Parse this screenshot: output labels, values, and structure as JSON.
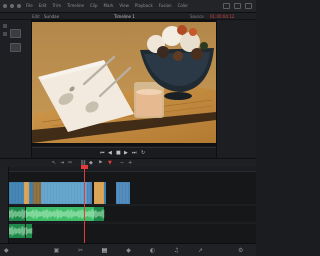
{
  "menu_bar": {
    "items": [
      "File",
      "Edit",
      "Trim",
      "Timeline",
      "Clip",
      "Mark",
      "View",
      "Playback",
      "Fusion",
      "Color"
    ]
  },
  "subbar": {
    "left_label": "Edit",
    "project_name": "Sundae",
    "timeline_title": "Timeline 1",
    "right_label": "Source",
    "timecode": "01:00:04:12"
  },
  "viewer": {
    "scene": "sundae-on-tray"
  },
  "transport": {
    "prev_label": "⏮",
    "back_label": "◀",
    "stop_label": "■",
    "play_label": "▶",
    "next_label": "⏭",
    "loop_label": "↻"
  },
  "tools": {
    "pointer": "↖",
    "trim": "⇥",
    "blade": "✂",
    "link": "⛓",
    "snap": "◆",
    "flag": "⚑",
    "marker": "▼",
    "zoom_in": "+",
    "zoom_out": "−"
  },
  "timeline": {
    "video_clip_colors": [
      "#3d7fb0",
      "#5ea0c9",
      "#8a6a3a",
      "#d8a050",
      "#4a86b8"
    ],
    "audio_colors": [
      "#1f8a4c",
      "#3fbf6a"
    ]
  },
  "pages": {
    "items": [
      {
        "name": "media",
        "glyph": "▣"
      },
      {
        "name": "cut",
        "glyph": "✂"
      },
      {
        "name": "edit",
        "glyph": "▤"
      },
      {
        "name": "fusion",
        "glyph": "◆"
      },
      {
        "name": "color",
        "glyph": "◐"
      },
      {
        "name": "fairlight",
        "glyph": "♫"
      },
      {
        "name": "deliver",
        "glyph": "➚"
      }
    ],
    "active": "edit"
  },
  "colors": {
    "accent": "#e23b3b",
    "panel": "#1e1f23",
    "background": "#161719"
  }
}
